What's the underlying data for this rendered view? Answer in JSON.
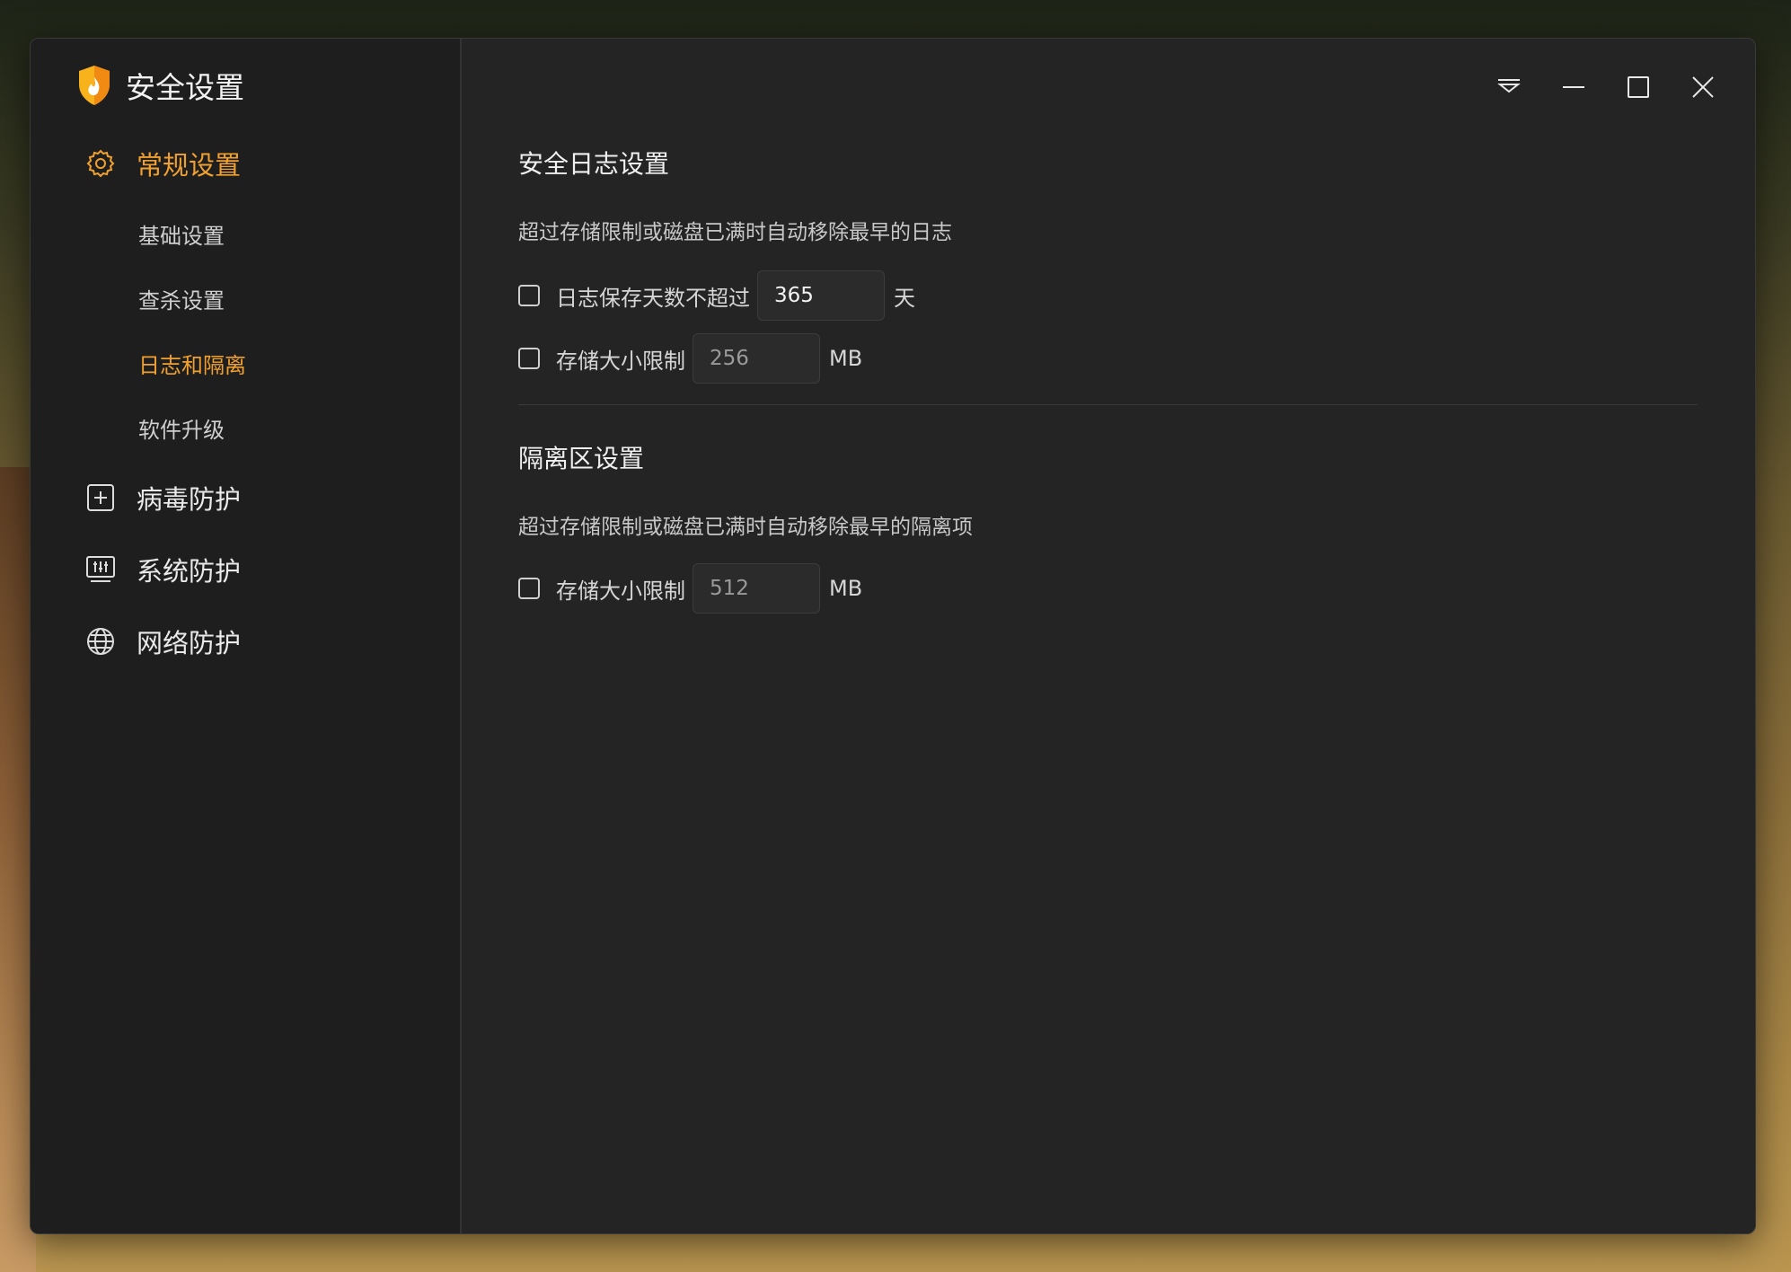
{
  "app": {
    "title": "安全设置"
  },
  "sidebar": {
    "nav": [
      {
        "label": "常规设置",
        "icon": "gear-icon"
      },
      {
        "label": "病毒防护",
        "icon": "plus-box-icon"
      },
      {
        "label": "系统防护",
        "icon": "monitor-sliders-icon"
      },
      {
        "label": "网络防护",
        "icon": "globe-icon"
      }
    ],
    "sub": [
      {
        "label": "基础设置"
      },
      {
        "label": "查杀设置"
      },
      {
        "label": "日志和隔离"
      },
      {
        "label": "软件升级"
      }
    ]
  },
  "log_section": {
    "title": "安全日志设置",
    "description": "超过存储限制或磁盘已满时自动移除最早的日志",
    "days": {
      "label": "日志保存天数不超过",
      "value": "365",
      "unit": "天"
    },
    "size": {
      "label": "存储大小限制",
      "value": "256",
      "unit": "MB"
    }
  },
  "quarantine_section": {
    "title": "隔离区设置",
    "description": "超过存储限制或磁盘已满时自动移除最早的隔离项",
    "size": {
      "label": "存储大小限制",
      "value": "512",
      "unit": "MB"
    }
  },
  "colors": {
    "accent": "#f0a030",
    "window_bg": "#242424",
    "sidebar_bg": "#1e1e1e"
  }
}
